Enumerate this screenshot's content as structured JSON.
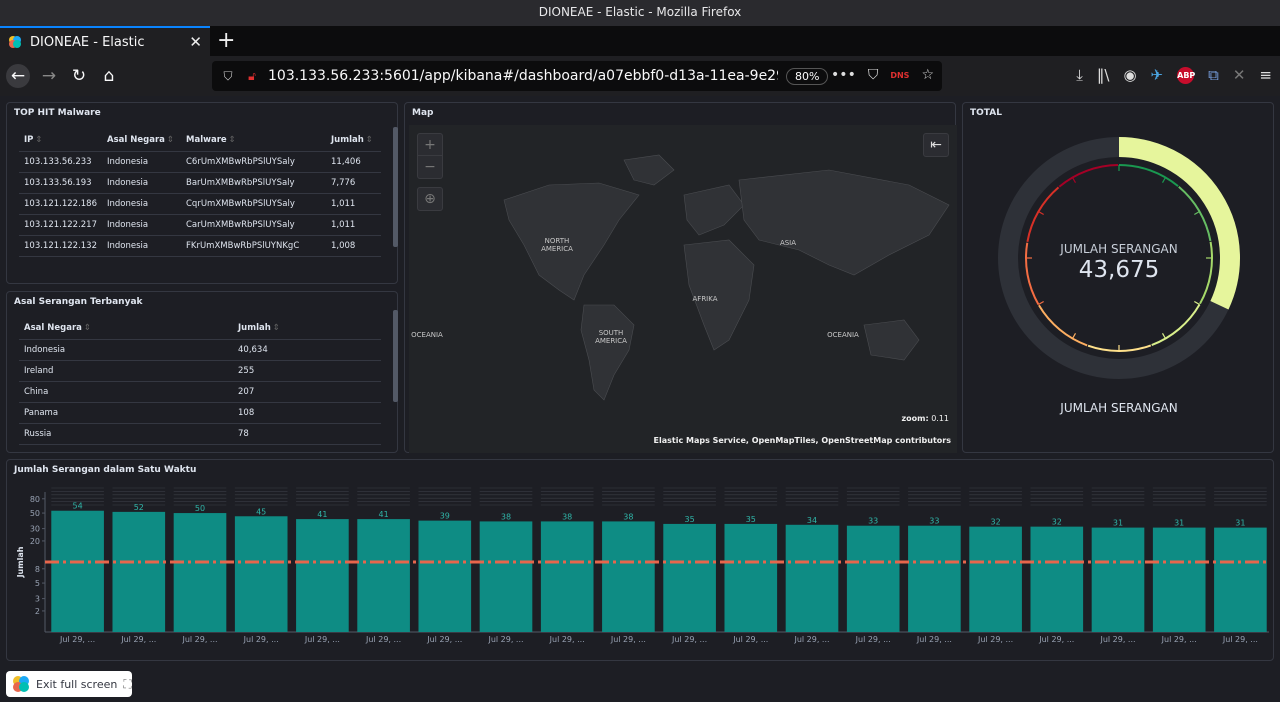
{
  "window": {
    "title": "DIONEAE - Elastic - Mozilla Firefox"
  },
  "tab": {
    "title": "DIONEAE - Elastic"
  },
  "url": {
    "text": "103.133.56.233:5601/app/kibana#/dashboard/a07ebbf0-d13a-11ea-9e29-a1a889f4",
    "zoom": "80%",
    "dns_label": "DNS",
    "abp_label": "ABP"
  },
  "malware_panel": {
    "title": "TOP HIT Malware",
    "columns": [
      "IP",
      "Asal Negara",
      "Malware",
      "Jumlah"
    ],
    "rows": [
      [
        "103.133.56.233",
        "Indonesia",
        "C6rUmXMBwRbPSlUYSaly",
        "11,406"
      ],
      [
        "103.133.56.193",
        "Indonesia",
        "BarUmXMBwRbPSlUYSaly",
        "7,776"
      ],
      [
        "103.121.122.186",
        "Indonesia",
        "CqrUmXMBwRbPSlUYSaly",
        "1,011"
      ],
      [
        "103.121.122.217",
        "Indonesia",
        "CarUmXMBwRbPSlUYSaly",
        "1,011"
      ],
      [
        "103.121.122.132",
        "Indonesia",
        "FKrUmXMBwRbPSlUYNKgC",
        "1,008"
      ]
    ]
  },
  "country_panel": {
    "title": "Asal Serangan Terbanyak",
    "columns": [
      "Asal Negara",
      "Jumlah"
    ],
    "rows": [
      [
        "Indonesia",
        "40,634"
      ],
      [
        "Ireland",
        "255"
      ],
      [
        "China",
        "207"
      ],
      [
        "Panama",
        "108"
      ],
      [
        "Russia",
        "78"
      ]
    ]
  },
  "map_panel": {
    "title": "Map",
    "labels": {
      "north_america": "NORTH AMERICA",
      "south_america": "SOUTH AMERICA",
      "asia": "ASIA",
      "africa": "AFRIKA",
      "oceania_left": "OCEANIA",
      "oceania_right": "OCEANIA"
    },
    "zoom_label": "zoom:",
    "zoom_value": "0.11",
    "attribution": "Elastic Maps Service, OpenMapTiles, OpenStreetMap contributors"
  },
  "total_panel": {
    "title": "TOTAL",
    "metric_label": "JUMLAH SERANGAN",
    "metric_value": "43,675",
    "bottom_label": "JUMLAH SERANGAN",
    "gauge_fraction": 0.32
  },
  "colors": {
    "bar": "#0e8c84",
    "threshold": "#e7664c",
    "gauge_fill": "#e6f59c",
    "gauge_track": "#2e3138"
  },
  "chart_data": {
    "type": "bar",
    "title": "Jumlah Serangan dalam Satu Waktu",
    "ylabel": "Jumlah",
    "xlabel": "",
    "yscale": "log",
    "yticks": [
      "2",
      "3",
      "5",
      "8",
      "20",
      "30",
      "50",
      "80"
    ],
    "categories": [
      "Jul 29, ...",
      "Jul 29, ...",
      "Jul 29, ...",
      "Jul 29, ...",
      "Jul 29, ...",
      "Jul 29, ...",
      "Jul 29, ...",
      "Jul 29, ...",
      "Jul 29, ...",
      "Jul 29, ...",
      "Jul 29, ...",
      "Jul 29, ...",
      "Jul 29, ...",
      "Jul 29, ...",
      "Jul 29, ...",
      "Jul 29, ...",
      "Jul 29, ...",
      "Jul 29, ...",
      "Jul 29, ...",
      "Jul 29, ..."
    ],
    "values": [
      54,
      52,
      50,
      45,
      41,
      41,
      39,
      38,
      38,
      38,
      35,
      35,
      34,
      33,
      33,
      32,
      32,
      31,
      31,
      31
    ],
    "threshold": 10,
    "ylim": [
      1,
      100
    ]
  },
  "exit_button": {
    "label": "Exit full screen"
  }
}
